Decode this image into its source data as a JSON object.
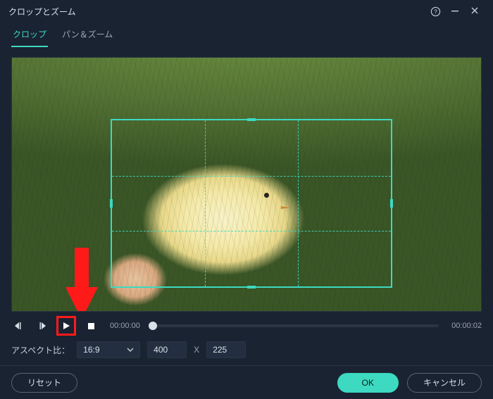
{
  "window": {
    "title": "クロップとズーム"
  },
  "tabs": {
    "crop": "クロップ",
    "panzoom": "パン＆ズーム"
  },
  "time": {
    "current": "00:00:00",
    "total": "00:00:02"
  },
  "aspect": {
    "label": "アスペクト比：",
    "ratio": "16:9",
    "width": "400",
    "sep": "X",
    "height": "225"
  },
  "buttons": {
    "reset": "リセット",
    "ok": "OK",
    "cancel": "キャンセル"
  }
}
